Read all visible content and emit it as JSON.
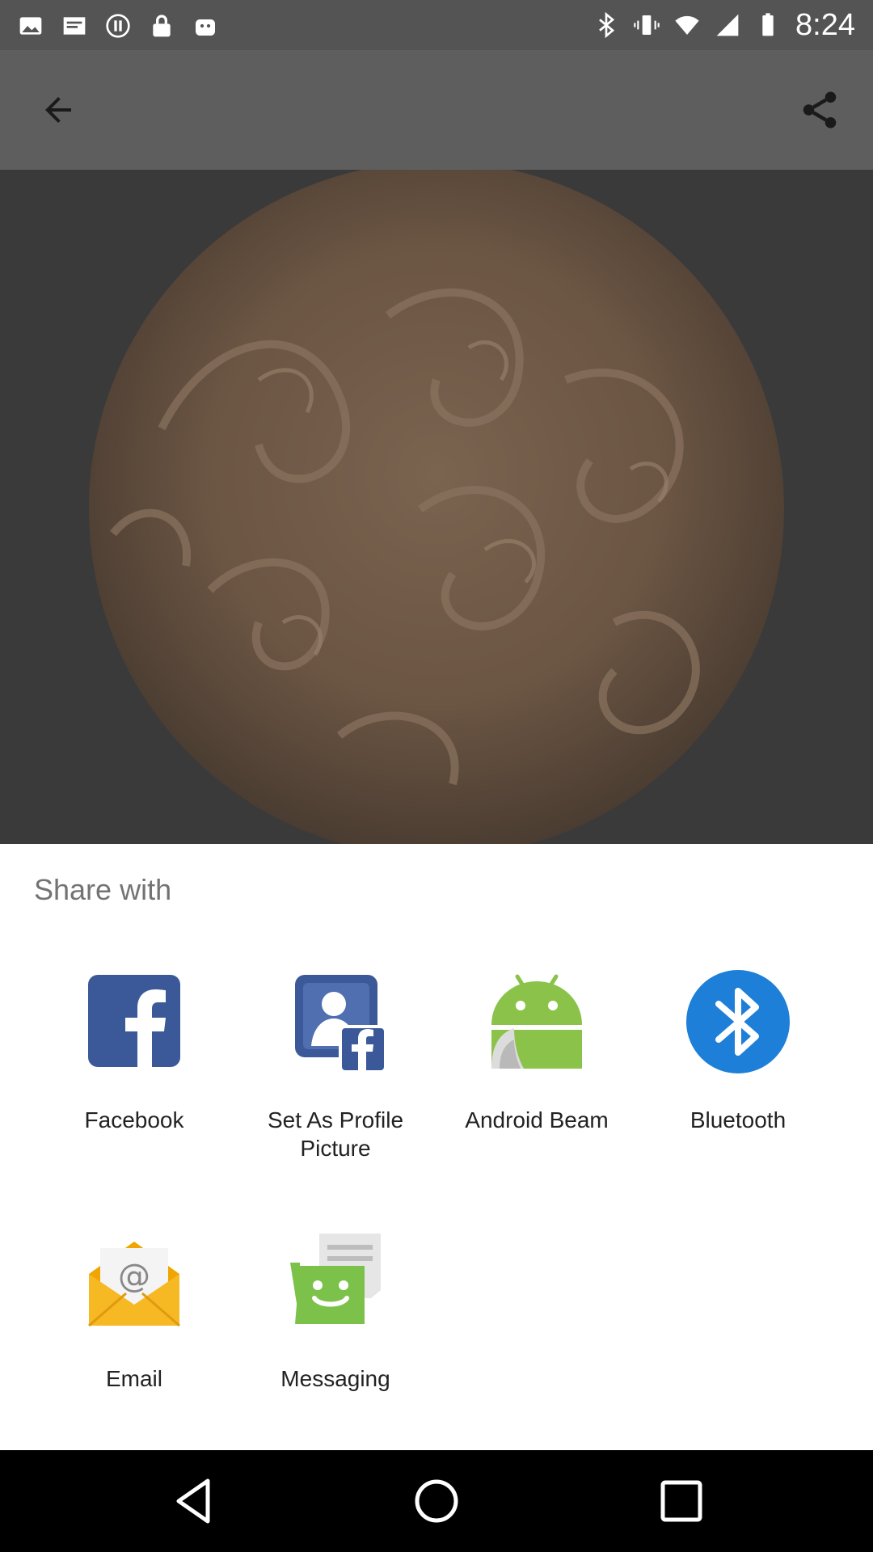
{
  "status_bar": {
    "time": "8:24",
    "left_icons": [
      "image-icon",
      "cast-icon",
      "pause-circle-icon",
      "lock-icon",
      "robot-icon"
    ],
    "right_icons": [
      "bluetooth-icon",
      "vibrate-icon",
      "wifi-icon",
      "signal-icon",
      "battery-icon"
    ]
  },
  "app_bar": {
    "back_icon": "arrow-back-icon",
    "share_icon": "share-icon",
    "background": "#5e5e5e"
  },
  "share_sheet": {
    "title": "Share with",
    "apps": [
      {
        "label": "Facebook",
        "icon": "facebook-icon"
      },
      {
        "label": "Set As Profile Picture",
        "icon": "profile-picture-icon"
      },
      {
        "label": "Android Beam",
        "icon": "android-beam-icon"
      },
      {
        "label": "Bluetooth",
        "icon": "bluetooth-icon"
      },
      {
        "label": "Email",
        "icon": "email-icon"
      },
      {
        "label": "Messaging",
        "icon": "messaging-icon"
      }
    ]
  },
  "colors": {
    "facebook_blue": "#3b5998",
    "android_green": "#8bc34a",
    "bluetooth_blue": "#1e7fd8",
    "email_yellow": "#f6b823",
    "messaging_green": "#7cc24a"
  },
  "nav_bar": {
    "icons": [
      "back-triangle-icon",
      "home-circle-icon",
      "recents-square-icon"
    ]
  }
}
